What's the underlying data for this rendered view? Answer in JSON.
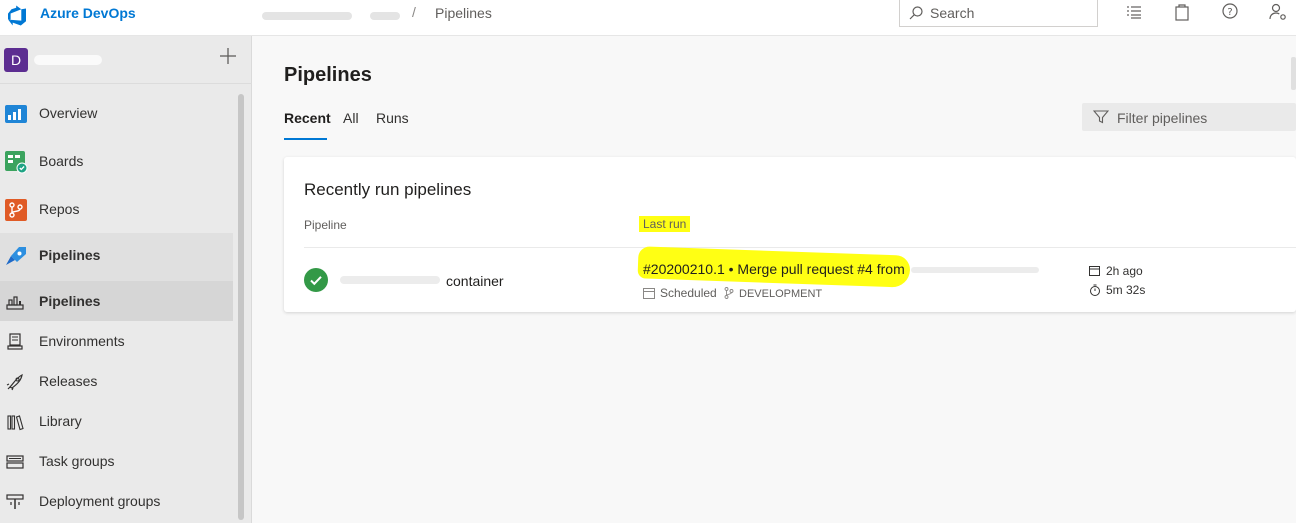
{
  "app": {
    "name": "Azure DevOps"
  },
  "breadcrumb": {
    "separator": "/",
    "current": "Pipelines"
  },
  "search": {
    "placeholder": "Search"
  },
  "topbar_icons": [
    "list-icon",
    "bag-icon",
    "help-icon",
    "user-settings-icon"
  ],
  "project": {
    "avatar_letter": "D"
  },
  "sidebar": {
    "items": [
      {
        "label": "Overview",
        "icon": "overview-icon"
      },
      {
        "label": "Boards",
        "icon": "boards-icon"
      },
      {
        "label": "Repos",
        "icon": "repos-icon"
      },
      {
        "label": "Pipelines",
        "icon": "pipelines-icon",
        "section": true
      },
      {
        "label": "Pipelines",
        "icon": "pipelines-sub-icon",
        "selected": true
      },
      {
        "label": "Environments",
        "icon": "environments-icon"
      },
      {
        "label": "Releases",
        "icon": "releases-icon"
      },
      {
        "label": "Library",
        "icon": "library-icon"
      },
      {
        "label": "Task groups",
        "icon": "task-groups-icon"
      },
      {
        "label": "Deployment groups",
        "icon": "deployment-groups-icon"
      }
    ]
  },
  "main": {
    "title": "Pipelines",
    "tabs": [
      {
        "label": "Recent",
        "active": true
      },
      {
        "label": "All"
      },
      {
        "label": "Runs"
      }
    ],
    "filter": {
      "placeholder": "Filter pipelines"
    }
  },
  "card": {
    "title": "Recently run pipelines",
    "columns": {
      "pipeline": "Pipeline",
      "last_run": "Last run"
    },
    "rows": [
      {
        "status": "succeeded",
        "pipeline_name": "container",
        "run_title": "#20200210.1 • Merge pull request #4 from",
        "trigger": "Scheduled",
        "branch": "DEVELOPMENT",
        "when": "2h ago",
        "duration": "5m 32s"
      }
    ]
  },
  "colors": {
    "accent": "#0078d4",
    "success": "#339947",
    "highlight": "#ffff14",
    "project": "#5c2d91"
  }
}
